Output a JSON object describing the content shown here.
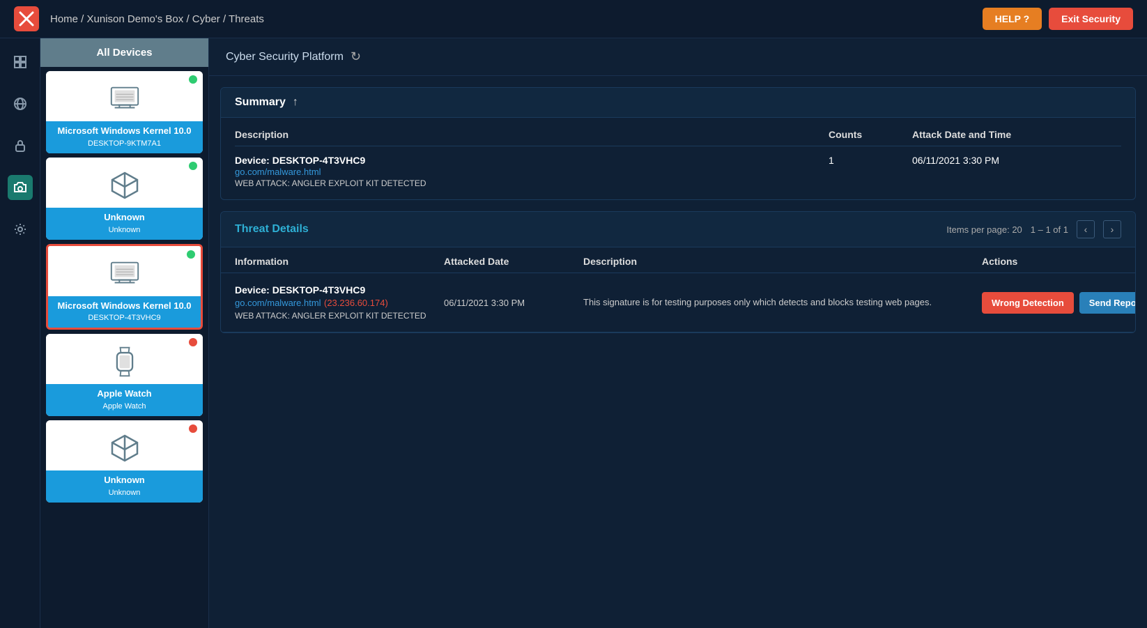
{
  "topnav": {
    "logo": "X",
    "breadcrumb": "Home / Xunison Demo's Box / Cyber / Threats",
    "help_label": "HELP ?",
    "exit_label": "Exit Security"
  },
  "device_panel": {
    "header": "All Devices",
    "devices": [
      {
        "id": "dev1",
        "name": "Microsoft Windows Kernel 10.0",
        "sub": "DESKTOP-9KTM7A1",
        "icon": "monitor",
        "status": "green",
        "selected": false
      },
      {
        "id": "dev2",
        "name": "Unknown",
        "sub": "Unknown",
        "icon": "shield",
        "status": "green",
        "selected": false
      },
      {
        "id": "dev3",
        "name": "Microsoft Windows Kernel 10.0",
        "sub": "DESKTOP-4T3VHC9",
        "icon": "monitor",
        "status": "green",
        "selected": true
      },
      {
        "id": "dev4",
        "name": "Apple Watch",
        "sub": "Apple Watch",
        "icon": "watch",
        "status": "red",
        "selected": false
      },
      {
        "id": "dev5",
        "name": "Unknown",
        "sub": "Unknown",
        "icon": "shield",
        "status": "red",
        "selected": false
      }
    ]
  },
  "content_header": {
    "title": "Cyber Security Platform",
    "refresh_icon": "↻"
  },
  "summary": {
    "title": "Summary",
    "up_icon": "↑",
    "col_description": "Description",
    "col_counts": "Counts",
    "col_attack_date": "Attack Date and Time",
    "rows": [
      {
        "device_label": "Device:",
        "device_name": "DESKTOP-4T3VHC9",
        "device_link": "go.com/malware.html",
        "attack_text": "WEB ATTACK: ANGLER EXPLOIT KIT DETECTED",
        "count": "1",
        "date": "06/11/2021 3:30 PM"
      }
    ]
  },
  "threat_details": {
    "title": "Threat Details",
    "items_per_page_label": "Items per page:",
    "items_per_page": "20",
    "range": "1 – 1 of 1",
    "col_information": "Information",
    "col_attacked_date": "Attacked Date",
    "col_description": "Description",
    "col_actions": "Actions",
    "rows": [
      {
        "device_label": "Device:",
        "device_name": "DESKTOP-4T3VHC9",
        "device_link": "go.com/malware.html",
        "device_ip": "(23.236.60.174)",
        "attack_text": "WEB ATTACK: ANGLER EXPLOIT KIT DETECTED",
        "attacked_date": "06/11/2021 3:30 PM",
        "description": "This signature is for testing purposes only which detects and blocks testing web pages.",
        "btn_wrong": "Wrong Detection",
        "btn_send": "Send Report"
      }
    ]
  },
  "sidebar_icons": [
    {
      "id": "grid",
      "label": "grid-icon"
    },
    {
      "id": "globe",
      "label": "globe-icon"
    },
    {
      "id": "lock",
      "label": "lock-icon"
    },
    {
      "id": "camera",
      "label": "camera-icon",
      "active": true
    },
    {
      "id": "settings",
      "label": "settings-icon"
    }
  ]
}
